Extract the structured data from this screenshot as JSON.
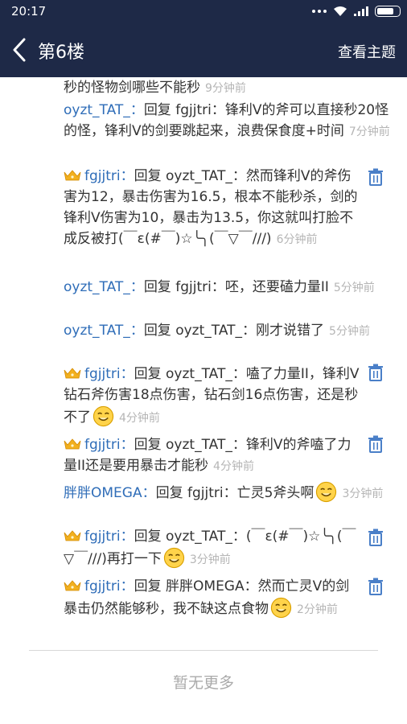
{
  "status_bar": {
    "time": "20:17"
  },
  "nav": {
    "title": "第6楼",
    "right_action": "查看主题"
  },
  "comments": [
    {
      "body": "秒的怪物剑哪些不能秒",
      "time": "9分钟前"
    },
    {
      "name": "oyzt_TAT_",
      "reply_word": "回复",
      "target": "fgjjtri",
      "body": "锋利V的斧可以直接秒20怪的怪，锋利V的剑要跳起来，浪费保食度+时间",
      "time": "7分钟前"
    },
    {
      "name": "fgjjtri",
      "reply_word": "回复",
      "target": "oyzt_TAT_",
      "body": "然而锋利V的斧伤害为12，暴击伤害为16.5，根本不能秒杀，剑的锋利V伤害为10，暴击为13.5，你这就叫打脸不成反被打(￣ε(#￣)☆╰╮(￣▽￣///)",
      "time": "6分钟前"
    },
    {
      "name": "oyzt_TAT_",
      "reply_word": "回复",
      "target": "fgjjtri",
      "body": "呸，还要磕力量II",
      "time": "5分钟前"
    },
    {
      "name": "oyzt_TAT_",
      "reply_word": "回复",
      "target": "oyzt_TAT_",
      "body": "刚才说错了",
      "time": "5分钟前"
    },
    {
      "name": "fgjjtri",
      "reply_word": "回复",
      "target": "oyzt_TAT_",
      "body": "嗑了力量II，锋利V钻石斧伤害18点伤害，钻石剑16点伤害，还是秒不了",
      "time": "4分钟前"
    },
    {
      "name": "fgjjtri",
      "reply_word": "回复",
      "target": "oyzt_TAT_",
      "body": "锋利V的斧嗑了力量II还是要用暴击才能秒",
      "time": "4分钟前"
    },
    {
      "name": "胖胖OMEGA",
      "reply_word": "回复",
      "target": "fgjjtri",
      "body": "亡灵5斧头啊",
      "time": "3分钟前"
    },
    {
      "name": "fgjjtri",
      "reply_word": "回复",
      "target": "oyzt_TAT_",
      "body": "(￣ε(#￣)☆╰╮(￣▽￣///)再打一下",
      "time": "3分钟前"
    },
    {
      "name": "fgjjtri",
      "reply_word": "回复",
      "target": "胖胖OMEGA",
      "body": "然而亡灵V的剑暴击仍然能够秒，我不缺这点食物",
      "time": "2分钟前"
    }
  ],
  "footer": {
    "no_more": "暂无更多"
  }
}
